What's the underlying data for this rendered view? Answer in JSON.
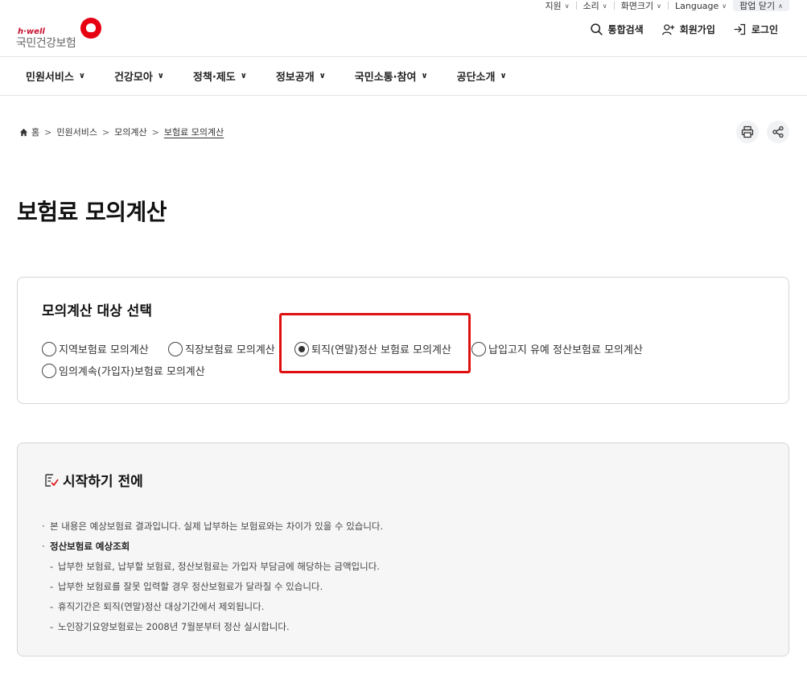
{
  "util": {
    "items": [
      {
        "label": "지원"
      },
      {
        "label": "소리"
      },
      {
        "label": "화면크기"
      },
      {
        "label": "Language"
      }
    ],
    "popup_close": "팝업 닫기"
  },
  "logo": {
    "tagline": "h·well",
    "name": "국민건강보험"
  },
  "header": {
    "search_label": "통합검색",
    "join_label": "회원가입",
    "login_label": "로그인"
  },
  "gnb": [
    {
      "label": "민원서비스"
    },
    {
      "label": "건강모아"
    },
    {
      "label": "정책·제도"
    },
    {
      "label": "정보공개"
    },
    {
      "label": "국민소통·참여"
    },
    {
      "label": "공단소개"
    }
  ],
  "breadcrumb": [
    "홈",
    "민원서비스",
    "모의계산",
    "보험료 모의계산"
  ],
  "page_title": "보험료 모의계산",
  "select": {
    "heading": "모의계산 대상 선택",
    "options": [
      {
        "label": "지역보험료 모의계산",
        "checked": false
      },
      {
        "label": "직장보험료 모의계산",
        "checked": false
      },
      {
        "label": "퇴직(연말)정산 보험료 모의계산",
        "checked": true
      },
      {
        "label": "납입고지 유예 정산보험료 모의계산",
        "checked": false
      },
      {
        "label": "임의계속(가입자)보험료 모의계산",
        "checked": false
      }
    ],
    "highlight_color": "#e01010"
  },
  "before": {
    "heading": "시작하기 전에",
    "items": [
      {
        "bullet": "·",
        "text": "본 내용은 예상보험료 결과입니다. 실제 납부하는 보험료와는 차이가 있을 수 있습니다."
      },
      {
        "bullet": "·",
        "text": "정산보험료 예상조회"
      },
      {
        "bullet": "-",
        "text": "납부한 보험료, 납부할 보험료, 정산보험료는 가입자 부담금에 해당하는 금액입니다."
      },
      {
        "bullet": "-",
        "text": "납부한 보험료를 잘못 입력할 경우 정산보험료가 달라질 수 있습니다."
      },
      {
        "bullet": "-",
        "text": "휴직기간은 퇴직(연말)정산 대상기간에서 제외됩니다."
      },
      {
        "bullet": "-",
        "text": "노인장기요양보험료는 2008년 7월분부터 정산 실시합니다."
      }
    ]
  }
}
